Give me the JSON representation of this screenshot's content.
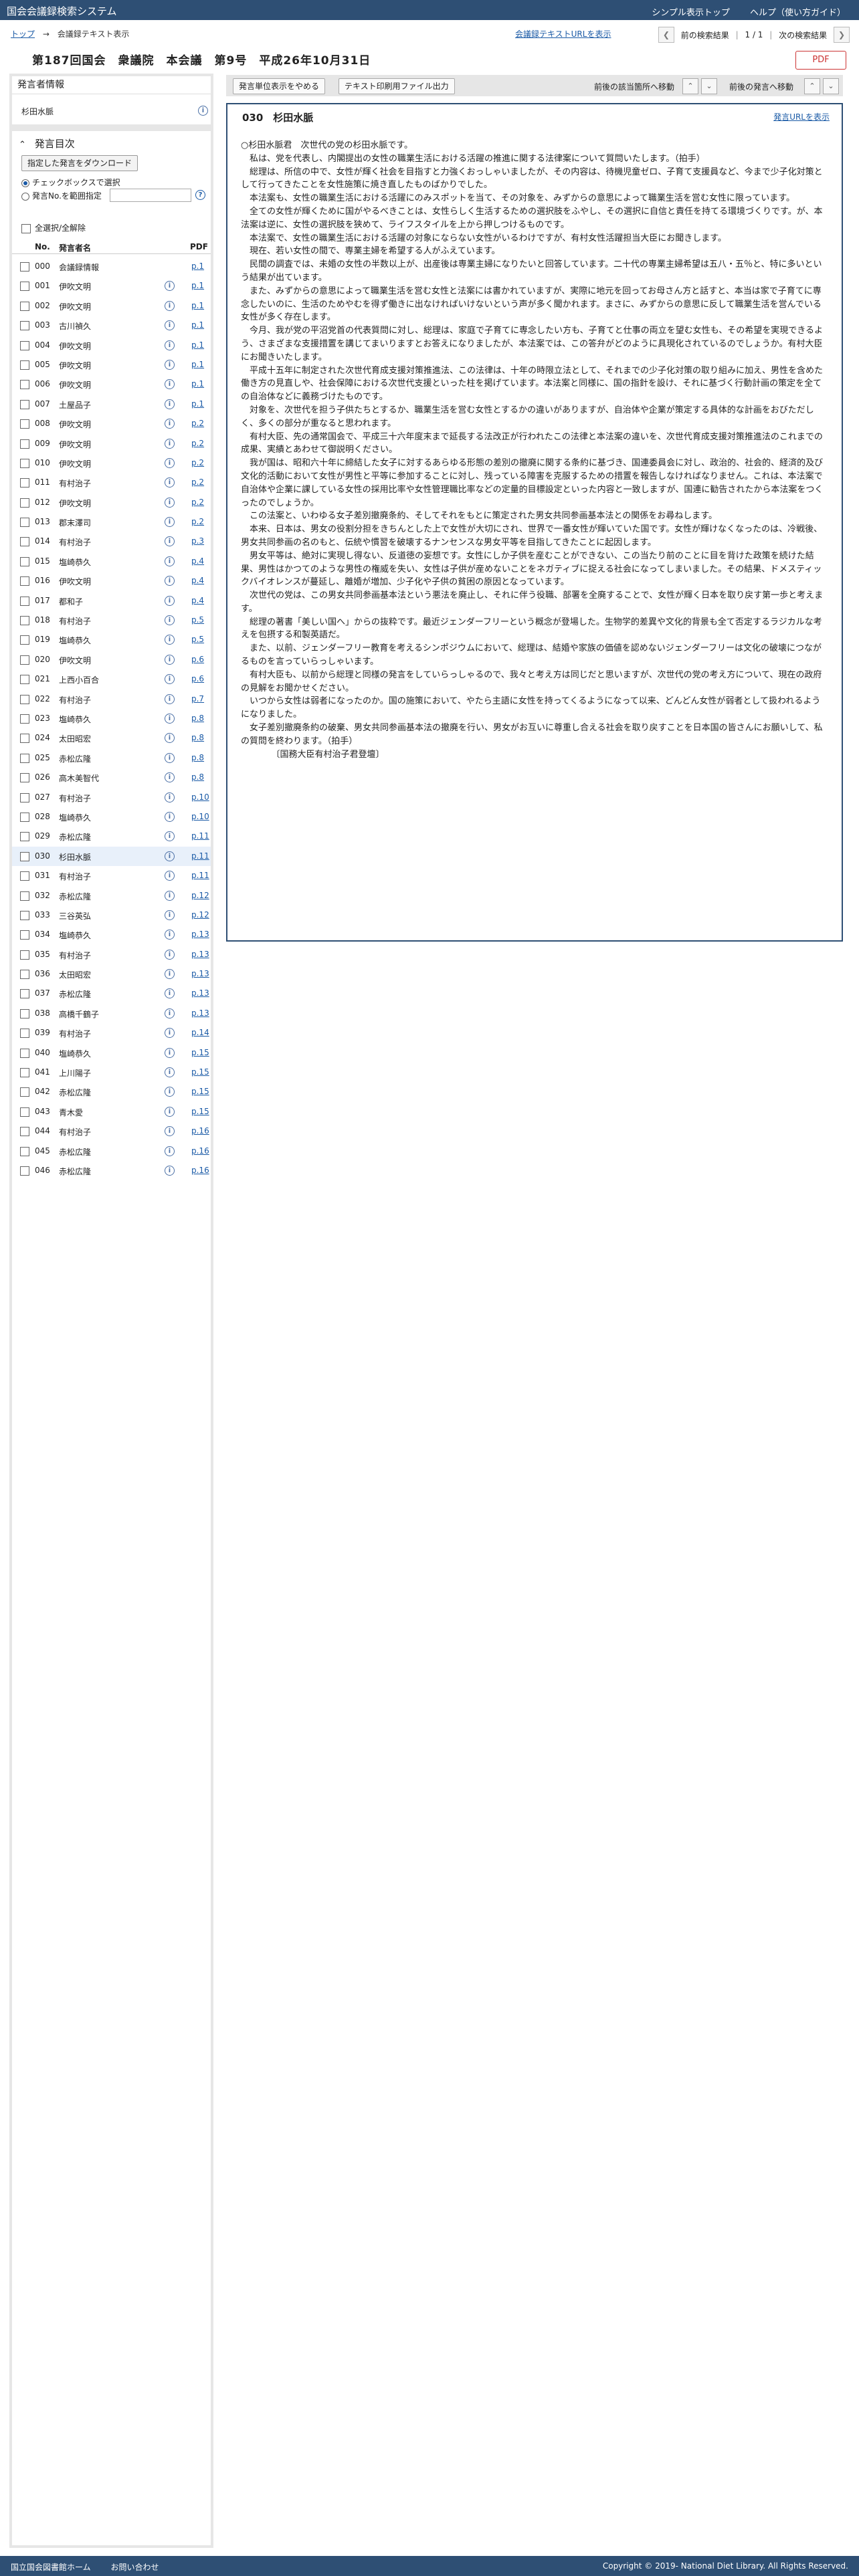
{
  "app_title": "国会会議録検索システム",
  "header_links": [
    "シンプル表示トップ",
    "ヘルプ（使い方ガイド）"
  ],
  "breadcrumb": {
    "home": "トップ",
    "arrow": "→",
    "current": "会議録テキスト表示"
  },
  "meeting_url_link": "会議録テキストURLを表示",
  "nav": {
    "prev": "前の検索結果",
    "position": "1 / 1",
    "next": "次の検索結果"
  },
  "meeting_title": "第187回国会　衆議院　本会議　第9号　平成26年10月31日",
  "pdf_label": "PDF",
  "speaker_info": {
    "heading": "発言者情報",
    "name": "杉田水脈"
  },
  "toc": {
    "heading": "発言目次",
    "download_button": "指定した発言をダウンロード",
    "radio_checkbox": "チェックボックスで選択",
    "radio_range": "発言No.を範囲指定",
    "select_all": "全選択/全解除",
    "col_no": "No.",
    "col_name": "発言者名",
    "col_pdf": "PDF",
    "items": [
      {
        "no": "000",
        "name": "会議録情報",
        "page": "p.1",
        "info": false
      },
      {
        "no": "001",
        "name": "伊吹文明",
        "page": "p.1",
        "info": true
      },
      {
        "no": "002",
        "name": "伊吹文明",
        "page": "p.1",
        "info": true
      },
      {
        "no": "003",
        "name": "古川禎久",
        "page": "p.1",
        "info": true
      },
      {
        "no": "004",
        "name": "伊吹文明",
        "page": "p.1",
        "info": true
      },
      {
        "no": "005",
        "name": "伊吹文明",
        "page": "p.1",
        "info": true
      },
      {
        "no": "006",
        "name": "伊吹文明",
        "page": "p.1",
        "info": true
      },
      {
        "no": "007",
        "name": "土屋品子",
        "page": "p.1",
        "info": true
      },
      {
        "no": "008",
        "name": "伊吹文明",
        "page": "p.2",
        "info": true
      },
      {
        "no": "009",
        "name": "伊吹文明",
        "page": "p.2",
        "info": true
      },
      {
        "no": "010",
        "name": "伊吹文明",
        "page": "p.2",
        "info": true
      },
      {
        "no": "011",
        "name": "有村治子",
        "page": "p.2",
        "info": true
      },
      {
        "no": "012",
        "name": "伊吹文明",
        "page": "p.2",
        "info": true
      },
      {
        "no": "013",
        "name": "郡末澤司",
        "page": "p.2",
        "info": true
      },
      {
        "no": "014",
        "name": "有村治子",
        "page": "p.3",
        "info": true
      },
      {
        "no": "015",
        "name": "塩崎恭久",
        "page": "p.4",
        "info": true
      },
      {
        "no": "016",
        "name": "伊吹文明",
        "page": "p.4",
        "info": true
      },
      {
        "no": "017",
        "name": "都和子",
        "page": "p.4",
        "info": true
      },
      {
        "no": "018",
        "name": "有村治子",
        "page": "p.5",
        "info": true
      },
      {
        "no": "019",
        "name": "塩崎恭久",
        "page": "p.5",
        "info": true
      },
      {
        "no": "020",
        "name": "伊吹文明",
        "page": "p.6",
        "info": true
      },
      {
        "no": "021",
        "name": "上西小百合",
        "page": "p.6",
        "info": true
      },
      {
        "no": "022",
        "name": "有村治子",
        "page": "p.7",
        "info": true
      },
      {
        "no": "023",
        "name": "塩崎恭久",
        "page": "p.8",
        "info": true
      },
      {
        "no": "024",
        "name": "太田昭宏",
        "page": "p.8",
        "info": true
      },
      {
        "no": "025",
        "name": "赤松広隆",
        "page": "p.8",
        "info": true
      },
      {
        "no": "026",
        "name": "高木美智代",
        "page": "p.8",
        "info": true
      },
      {
        "no": "027",
        "name": "有村治子",
        "page": "p.10",
        "info": true
      },
      {
        "no": "028",
        "name": "塩崎恭久",
        "page": "p.10",
        "info": true
      },
      {
        "no": "029",
        "name": "赤松広隆",
        "page": "p.11",
        "info": true
      },
      {
        "no": "030",
        "name": "杉田水脈",
        "page": "p.11",
        "info": true,
        "selected": true
      },
      {
        "no": "031",
        "name": "有村治子",
        "page": "p.11",
        "info": true
      },
      {
        "no": "032",
        "name": "赤松広隆",
        "page": "p.12",
        "info": true
      },
      {
        "no": "033",
        "name": "三谷英弘",
        "page": "p.12",
        "info": true
      },
      {
        "no": "034",
        "name": "塩崎恭久",
        "page": "p.13",
        "info": true
      },
      {
        "no": "035",
        "name": "有村治子",
        "page": "p.13",
        "info": true
      },
      {
        "no": "036",
        "name": "太田昭宏",
        "page": "p.13",
        "info": true
      },
      {
        "no": "037",
        "name": "赤松広隆",
        "page": "p.13",
        "info": true
      },
      {
        "no": "038",
        "name": "高橋千鶴子",
        "page": "p.13",
        "info": true
      },
      {
        "no": "039",
        "name": "有村治子",
        "page": "p.14",
        "info": true
      },
      {
        "no": "040",
        "name": "塩崎恭久",
        "page": "p.15",
        "info": true
      },
      {
        "no": "041",
        "name": "上川陽子",
        "page": "p.15",
        "info": true
      },
      {
        "no": "042",
        "name": "赤松広隆",
        "page": "p.15",
        "info": true
      },
      {
        "no": "043",
        "name": "青木愛",
        "page": "p.15",
        "info": true
      },
      {
        "no": "044",
        "name": "有村治子",
        "page": "p.16",
        "info": true
      },
      {
        "no": "045",
        "name": "赤松広隆",
        "page": "p.16",
        "info": true
      },
      {
        "no": "046",
        "name": "赤松広隆",
        "page": "p.16",
        "info": true
      }
    ]
  },
  "toolbar": {
    "unit_display": "発言単位表示をやめる",
    "print_file": "テキスト印刷用ファイル出力",
    "nav_match": "前後の該当箇所へ移動",
    "nav_speech": "前後の発言へ移動"
  },
  "speech": {
    "heading": "030　杉田水脈",
    "url_link": "発言URLを表示",
    "paragraphs": [
      "○杉田水脈君　次世代の党の杉田水脈です。",
      "　私は、党を代表し、内閣提出の女性の職業生活における活躍の推進に関する法律案について質問いたします。（拍手）",
      "　総理は、所信の中で、女性が輝く社会を目指すと力強くおっしゃいましたが、その内容は、待機児童ゼロ、子育て支援員など、今まで少子化対策として行ってきたことを女性施策に焼き直したものばかりでした。",
      "　本法案も、女性の職業生活における活躍にのみスポットを当て、その対象を、みずからの意思によって職業生活を営む女性に限っています。",
      "　全ての女性が輝くために国がやるべきことは、女性らしく生活するための選択肢をふやし、その選択に自信と責任を持てる環境づくりです。が、本法案は逆に、女性の選択肢を狭めて、ライフスタイルを上から押しつけるものです。",
      "　本法案で、女性の職業生活における活躍の対象にならない女性がいるわけですが、有村女性活躍担当大臣にお聞きします。",
      "　現在、若い女性の間で、専業主婦を希望する人がふえています。",
      "　民間の調査では、未婚の女性の半数以上が、出産後は専業主婦になりたいと回答しています。二十代の専業主婦希望は五八・五％と、特に多いという結果が出ています。",
      "　また、みずからの意思によって職業生活を営む女性と法案には書かれていますが、実際に地元を回ってお母さん方と話すと、本当は家で子育てに専念したいのに、生活のためやむを得ず働きに出なければいけないという声が多く聞かれます。まさに、みずからの意思に反して職業生活を営んでいる女性が多く存在します。",
      "　今月、我が党の平沼党首の代表質問に対し、総理は、家庭で子育てに専念したい方も、子育てと仕事の両立を望む女性も、その希望を実現できるよう、さまざまな支援措置を講じてまいりますとお答えになりましたが、本法案では、この答弁がどのように具現化されているのでしょうか。有村大臣にお聞きいたします。",
      "　平成十五年に制定された次世代育成支援対策推進法、この法律は、十年の時限立法として、それまでの少子化対策の取り組みに加え、男性を含めた働き方の見直しや、社会保障における次世代支援といった柱を掲げています。本法案と同様に、国の指針を設け、それに基づく行動計画の策定を全ての自治体などに義務づけたものです。",
      "　対象を、次世代を担う子供たちとするか、職業生活を営む女性とするかの違いがありますが、自治体や企業が策定する具体的な計画をおびただしく、多くの部分が重なると思われます。",
      "　有村大臣、先の通常国会で、平成三十六年度末まで延長する法改正が行われたこの法律と本法案の違いを、次世代育成支援対策推進法のこれまでの成果、実績とあわせて御説明ください。",
      "　我が国は、昭和六十年に締結した女子に対するあらゆる形態の差別の撤廃に関する条約に基づき、国連委員会に対し、政治的、社会的、経済的及び文化的活動において女性が男性と平等に参加することに対し、残っている障害を克服するための措置を報告しなければなりません。これは、本法案で自治体や企業に課している女性の採用比率や女性管理職比率などの定量的目標設定といった内容と一致しますが、国連に勧告されたから本法案をつくったのでしょうか。",
      "　この法案と、いわゆる女子差別撤廃条約、そしてそれをもとに策定された男女共同参画基本法との関係をお尋ねします。",
      "　本来、日本は、男女の役割分担をきちんとした上で女性が大切にされ、世界で一番女性が輝いていた国です。女性が輝けなくなったのは、冷戦後、男女共同参画の名のもと、伝統や慣習を破壊するナンセンスな男女平等を目指してきたことに起因します。",
      "　男女平等は、絶対に実現し得ない、反道徳の妄想です。女性にしか子供を産むことができない、この当たり前のことに目を背けた政策を続けた結果、男性はかつてのような男性の権威を失い、女性は子供が産めないことをネガティブに捉える社会になってしまいました。その結果、ドメスティックバイオレンスが蔓延し、離婚が増加、少子化や子供の貧困の原因となっています。",
      "　次世代の党は、この男女共同参画基本法という悪法を廃止し、それに伴う役職、部署を全廃することで、女性が輝く日本を取り戻す第一歩と考えます。",
      "　総理の著書「美しい国へ」からの抜粋です。最近ジェンダーフリーという概念が登場した。生物学的差異や文化的背景も全て否定するラジカルな考えを包摂する和製英語だ。",
      "　また、以前、ジェンダーフリー教育を考えるシンポジウムにおいて、総理は、結婚や家族の価値を認めないジェンダーフリーは文化の破壊につながるものを言っていらっしゃいます。",
      "　有村大臣も、以前から総理と同様の発言をしていらっしゃるので、我々と考え方は同じだと思いますが、次世代の党の考え方について、現在の政府の見解をお聞かせください。",
      "　いつから女性は弱者になったのか。国の施策において、やたら主語に女性を持ってくるようになって以来、どんどん女性が弱者として扱われるようになりました。",
      "　女子差別撤廃条約の破棄、男女共同参画基本法の撤廃を行い、男女がお互いに尊重し合える社会を取り戻すことを日本国の皆さんにお願いして、私の質問を終わります。（拍手）",
      "　　　　〔国務大臣有村治子君登壇〕"
    ]
  },
  "footer": {
    "links": [
      "国立国会図書館ホーム",
      "お問い合わせ"
    ],
    "copyright": "Copyright © 2019- National Diet Library. All Rights Reserved."
  }
}
